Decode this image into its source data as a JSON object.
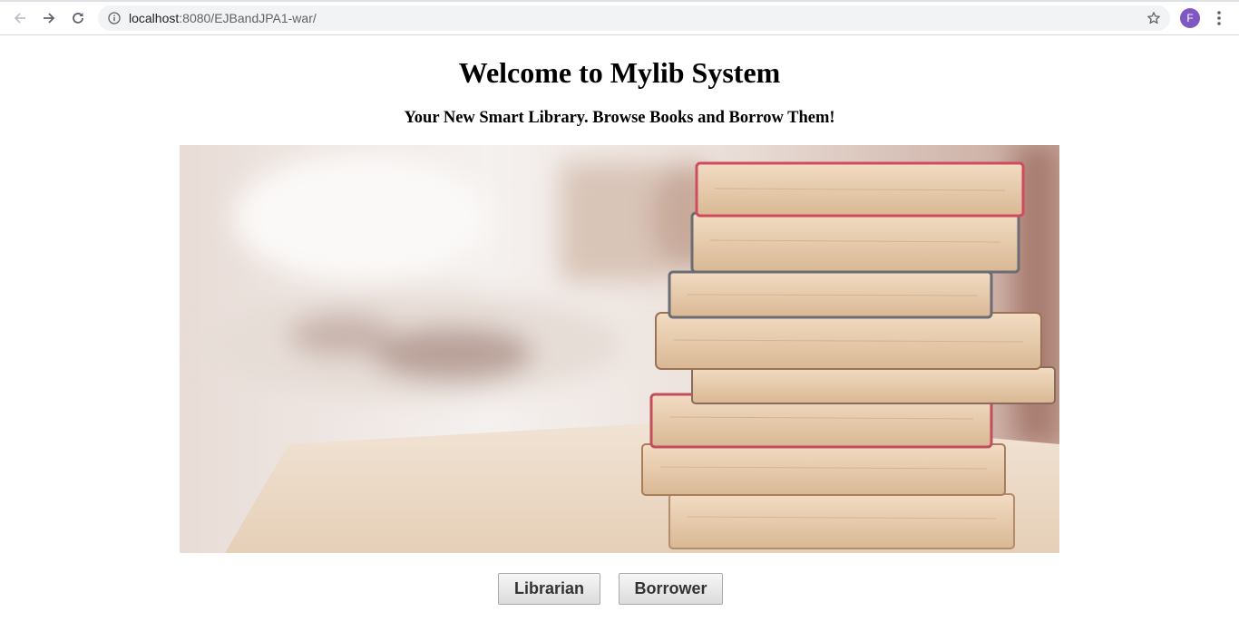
{
  "browser": {
    "url_host": "localhost",
    "url_path": ":8080/EJBandJPA1-war/",
    "avatar_letter": "F",
    "colors": {
      "avatar": "#7e57c2",
      "omnibox": "#f1f3f4"
    },
    "icons": [
      "back-arrow-icon",
      "forward-arrow-icon",
      "reload-icon",
      "info-icon",
      "star-icon",
      "kebab-menu-icon"
    ]
  },
  "page": {
    "title": "Welcome to Mylib System",
    "subtitle": "Your New Smart Library. Browse Books and Borrow Them!",
    "buttons": {
      "librarian": "Librarian",
      "borrower": "Borrower"
    }
  }
}
